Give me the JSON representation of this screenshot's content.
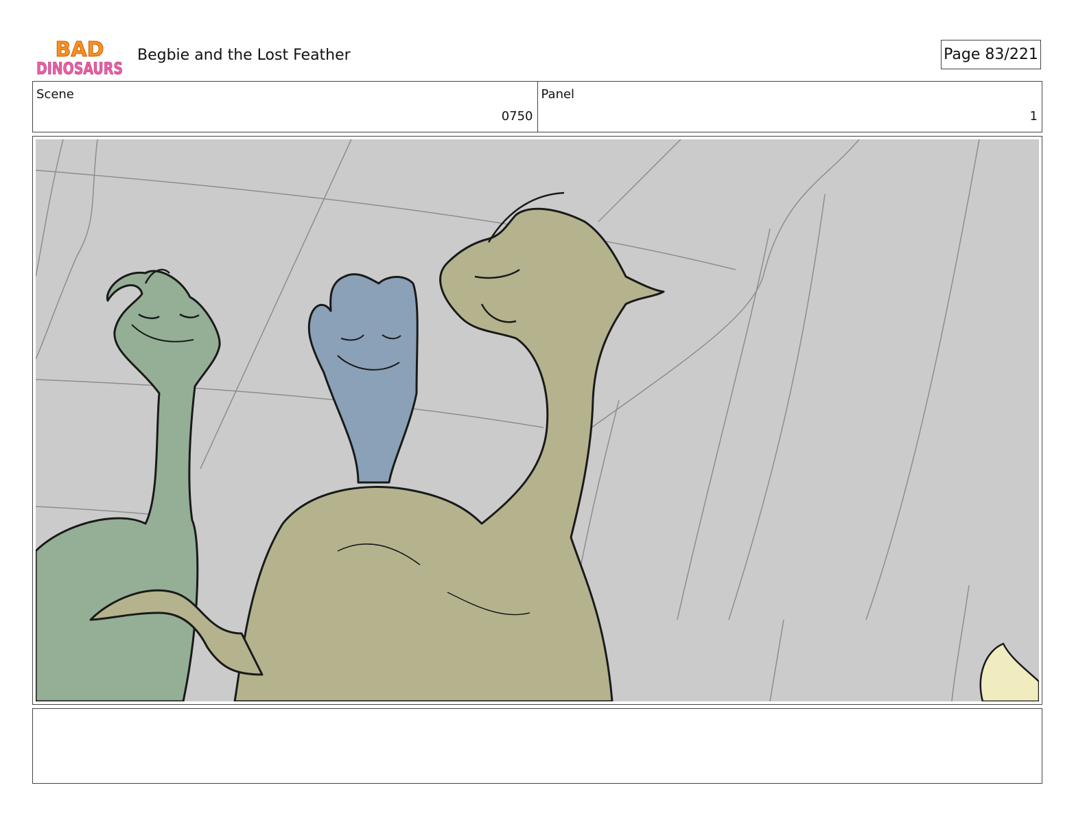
{
  "header": {
    "logo_line1": "BAD",
    "logo_line2": "DINOSAURS",
    "title": "Begbie and the Lost Feather",
    "page_label": "Page",
    "page_value": "83/221"
  },
  "info": {
    "scene_label": "Scene",
    "scene_value": "0750",
    "panel_label": "Panel",
    "panel_value": "1"
  },
  "artwork": {
    "icons": [
      "green-dinosaur-icon",
      "blue-dinosaur-icon",
      "tan-dinosaur-icon"
    ],
    "colors": {
      "background": "#cbcbcb",
      "green_dino": "#94af96",
      "blue_dino": "#8aa1b8",
      "tan_dino": "#b5b38e",
      "feather": "#f0ecc0"
    }
  },
  "notes": {
    "text": ""
  }
}
